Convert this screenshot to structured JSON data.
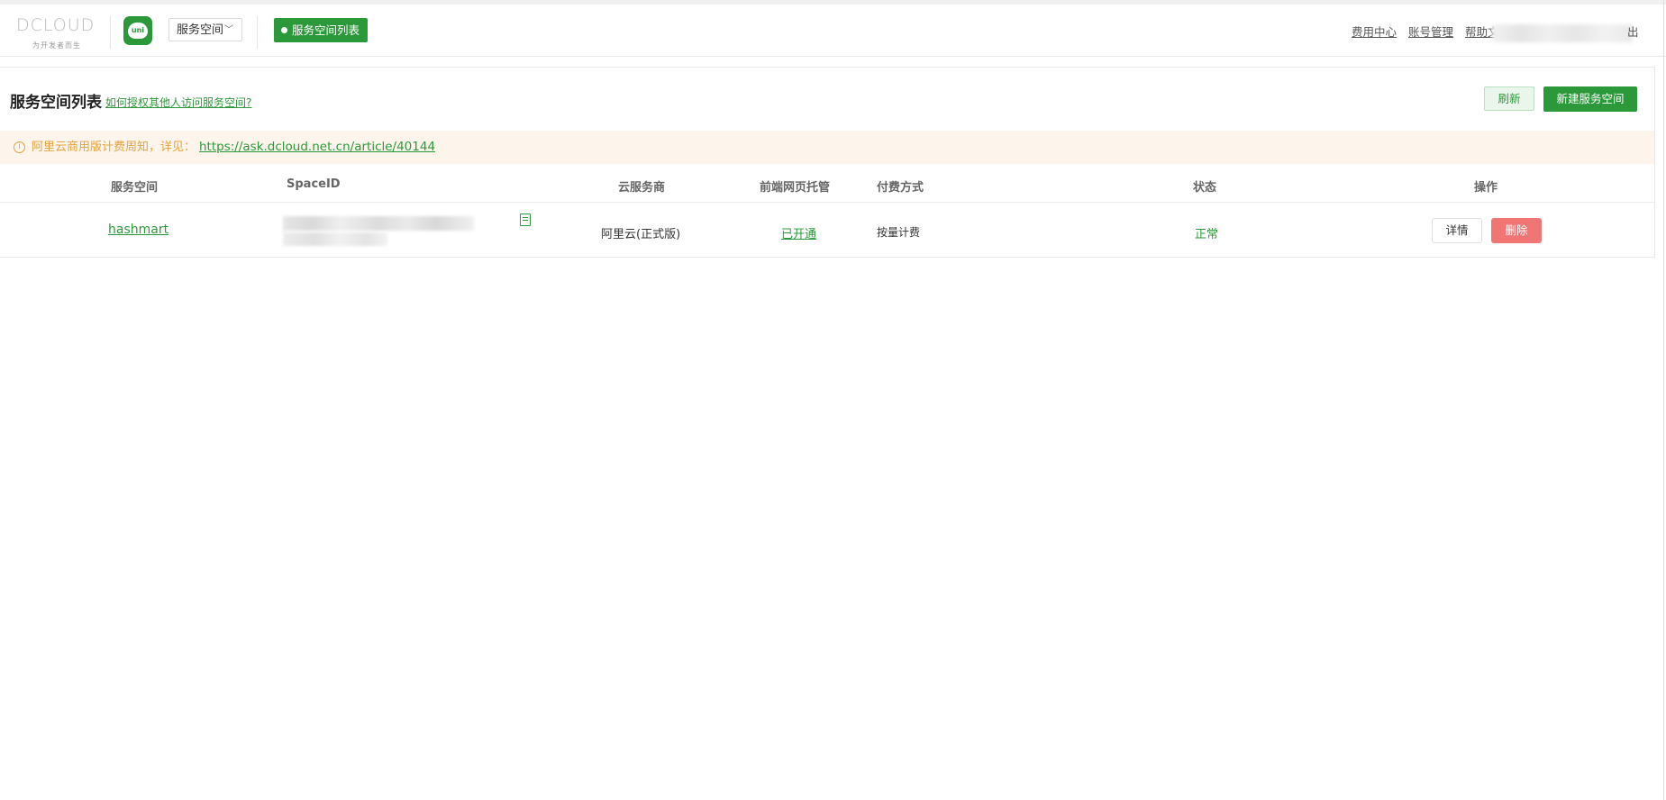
{
  "brand": {
    "logo_text": "DCLOUD",
    "slogan": "为开发者而生",
    "uni_label": "uni"
  },
  "header": {
    "space_selector": "服务空间",
    "current_tab": "服务空间列表",
    "links": [
      "费用中心",
      "账号管理",
      "帮助文"
    ],
    "logout": "出"
  },
  "page": {
    "title": "服务空间列表",
    "help_link": "如何授权其他人访问服务空间?",
    "refresh_label": "刷新",
    "new_label": "新建服务空间"
  },
  "notice": {
    "text": "阿里云商用版计费周知，详见：",
    "link": "https://ask.dcloud.net.cn/article/40144"
  },
  "table": {
    "columns": [
      "服务空间",
      "SpaceID",
      "云服务商",
      "前端网页托管",
      "付费方式",
      "状态",
      "操作"
    ],
    "rows": [
      {
        "name": "hashmart",
        "provider": "阿里云(正式版)",
        "hosting": "已开通",
        "billing": "按量计费",
        "status": "正常",
        "detail_label": "详情",
        "delete_label": "删除"
      }
    ]
  },
  "colors": {
    "accent": "#2b9939",
    "warning": "#e6a23c",
    "danger": "#f07575",
    "notice_bg": "#fdf5ec"
  }
}
